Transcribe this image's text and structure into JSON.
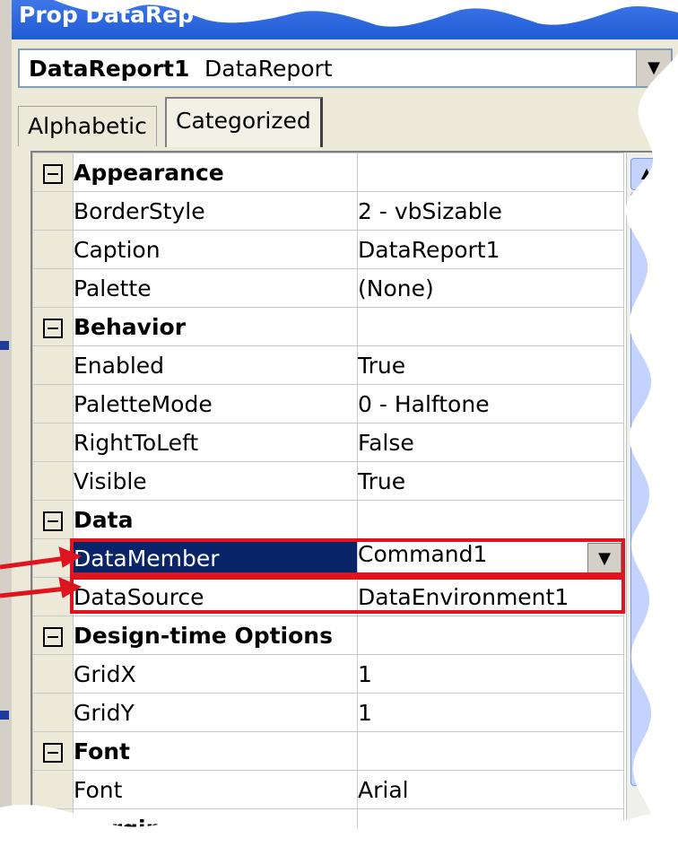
{
  "window": {
    "title": "Prop        DataRep"
  },
  "object_selector": {
    "object_name": "DataReport1",
    "object_type": "DataReport"
  },
  "tabs": [
    {
      "label": "Alphabetic",
      "active": false
    },
    {
      "label": "Categorized",
      "active": true
    }
  ],
  "categories": [
    {
      "name": "Appearance",
      "properties": [
        {
          "name": "BorderStyle",
          "value": "2 - vbSizable"
        },
        {
          "name": "Caption",
          "value": "DataReport1"
        },
        {
          "name": "Palette",
          "value": "(None)"
        }
      ]
    },
    {
      "name": "Behavior",
      "properties": [
        {
          "name": "Enabled",
          "value": "True"
        },
        {
          "name": "PaletteMode",
          "value": "0 - Halftone"
        },
        {
          "name": "RightToLeft",
          "value": "False"
        },
        {
          "name": "Visible",
          "value": "True"
        }
      ]
    },
    {
      "name": "Data",
      "properties": [
        {
          "name": "DataMember",
          "value": "Command1"
        },
        {
          "name": "DataSource",
          "value": "DataEnvironment1"
        }
      ]
    },
    {
      "name": "Design-time Options",
      "properties": [
        {
          "name": "GridX",
          "value": "1"
        },
        {
          "name": "GridY",
          "value": "1"
        }
      ]
    },
    {
      "name": "Font",
      "properties": [
        {
          "name": "Font",
          "value": "Arial"
        }
      ]
    },
    {
      "name": "Margins",
      "properties": []
    }
  ],
  "colors": {
    "selection": "#0a246a",
    "highlight_box": "#e0141e",
    "titlebar": "#2a62dc"
  },
  "icons": {
    "collapse": "minus-box-icon",
    "dropdown": "down-arrow-icon",
    "scroll_up": "chevron-up-icon"
  }
}
